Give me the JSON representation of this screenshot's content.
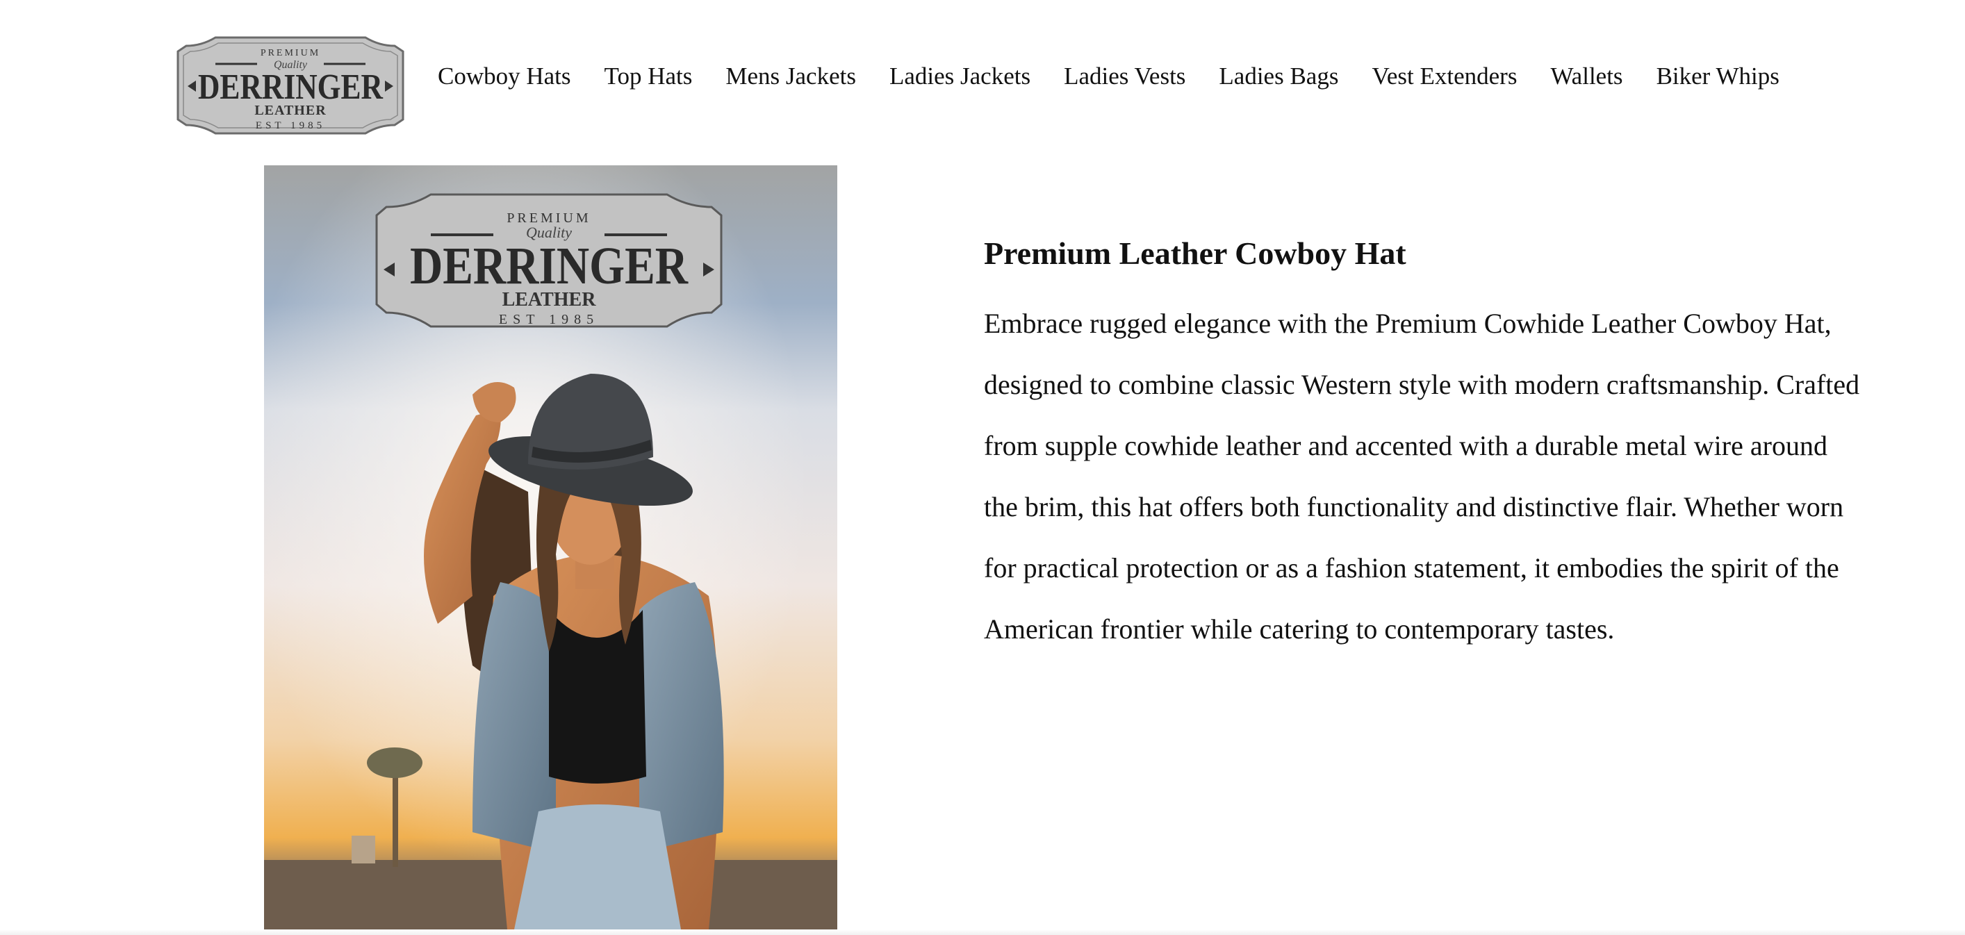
{
  "brand": {
    "logo_top": "PREMIUM",
    "logo_script": "Quality",
    "logo_name": "DERRINGER",
    "logo_sub": "LEATHER",
    "logo_est": "EST 1985",
    "logo_color": "#bdbdbd"
  },
  "nav": {
    "items": [
      {
        "label": "Cowboy Hats"
      },
      {
        "label": "Top Hats"
      },
      {
        "label": "Mens Jackets"
      },
      {
        "label": "Ladies Jackets"
      },
      {
        "label": "Ladies Vests"
      },
      {
        "label": "Ladies Bags"
      },
      {
        "label": "Vest Extenders"
      },
      {
        "label": "Wallets"
      },
      {
        "label": "Biker Whips"
      }
    ]
  },
  "product": {
    "title": "Premium Leather Cowboy Hat",
    "description": "Embrace rugged elegance with the Premium Cowhide Leather Cowboy Hat, designed to combine classic Western style with modern craftsmanship. Crafted from supple cowhide leather and accented with a durable metal wire around the brim, this hat offers both functionality and distinctive flair. Whether worn for practical protection or as a fashion statement, it embodies the spirit of the American frontier while catering to contemporary tastes.",
    "image_subject": "woman-in-cowboy-hat-photo"
  },
  "colors": {
    "text": "#111111",
    "background": "#ffffff",
    "sky_top": "#9a9c9c",
    "sky_glow": "#f4f1ee",
    "sunset": "#f0b050"
  }
}
